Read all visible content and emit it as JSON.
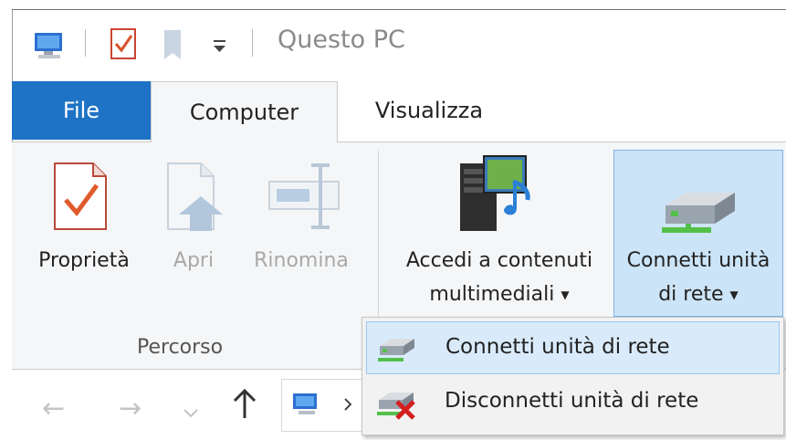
{
  "window": {
    "title": "Questo PC"
  },
  "tabs": [
    {
      "label": "File"
    },
    {
      "label": "Computer"
    },
    {
      "label": "Visualizza"
    }
  ],
  "ribbon": {
    "buttons": [
      {
        "label": "Proprietà"
      },
      {
        "label": "Apri"
      },
      {
        "label": "Rinomina"
      },
      {
        "label_line1": "Accedi a contenuti",
        "label_line2": "multimediali"
      },
      {
        "label_line1": "Connetti unità",
        "label_line2": "di rete"
      }
    ],
    "group_label": "Percorso"
  },
  "dropdown": {
    "items": [
      {
        "label": "Connetti unità di rete"
      },
      {
        "label": "Disconnetti unità di rete"
      }
    ]
  },
  "colors": {
    "file_tab": "#1e73c6",
    "ribbon_bg": "#f5f6f7",
    "highlight": "#cce4f7",
    "highlight_border": "#7eb4ea"
  }
}
